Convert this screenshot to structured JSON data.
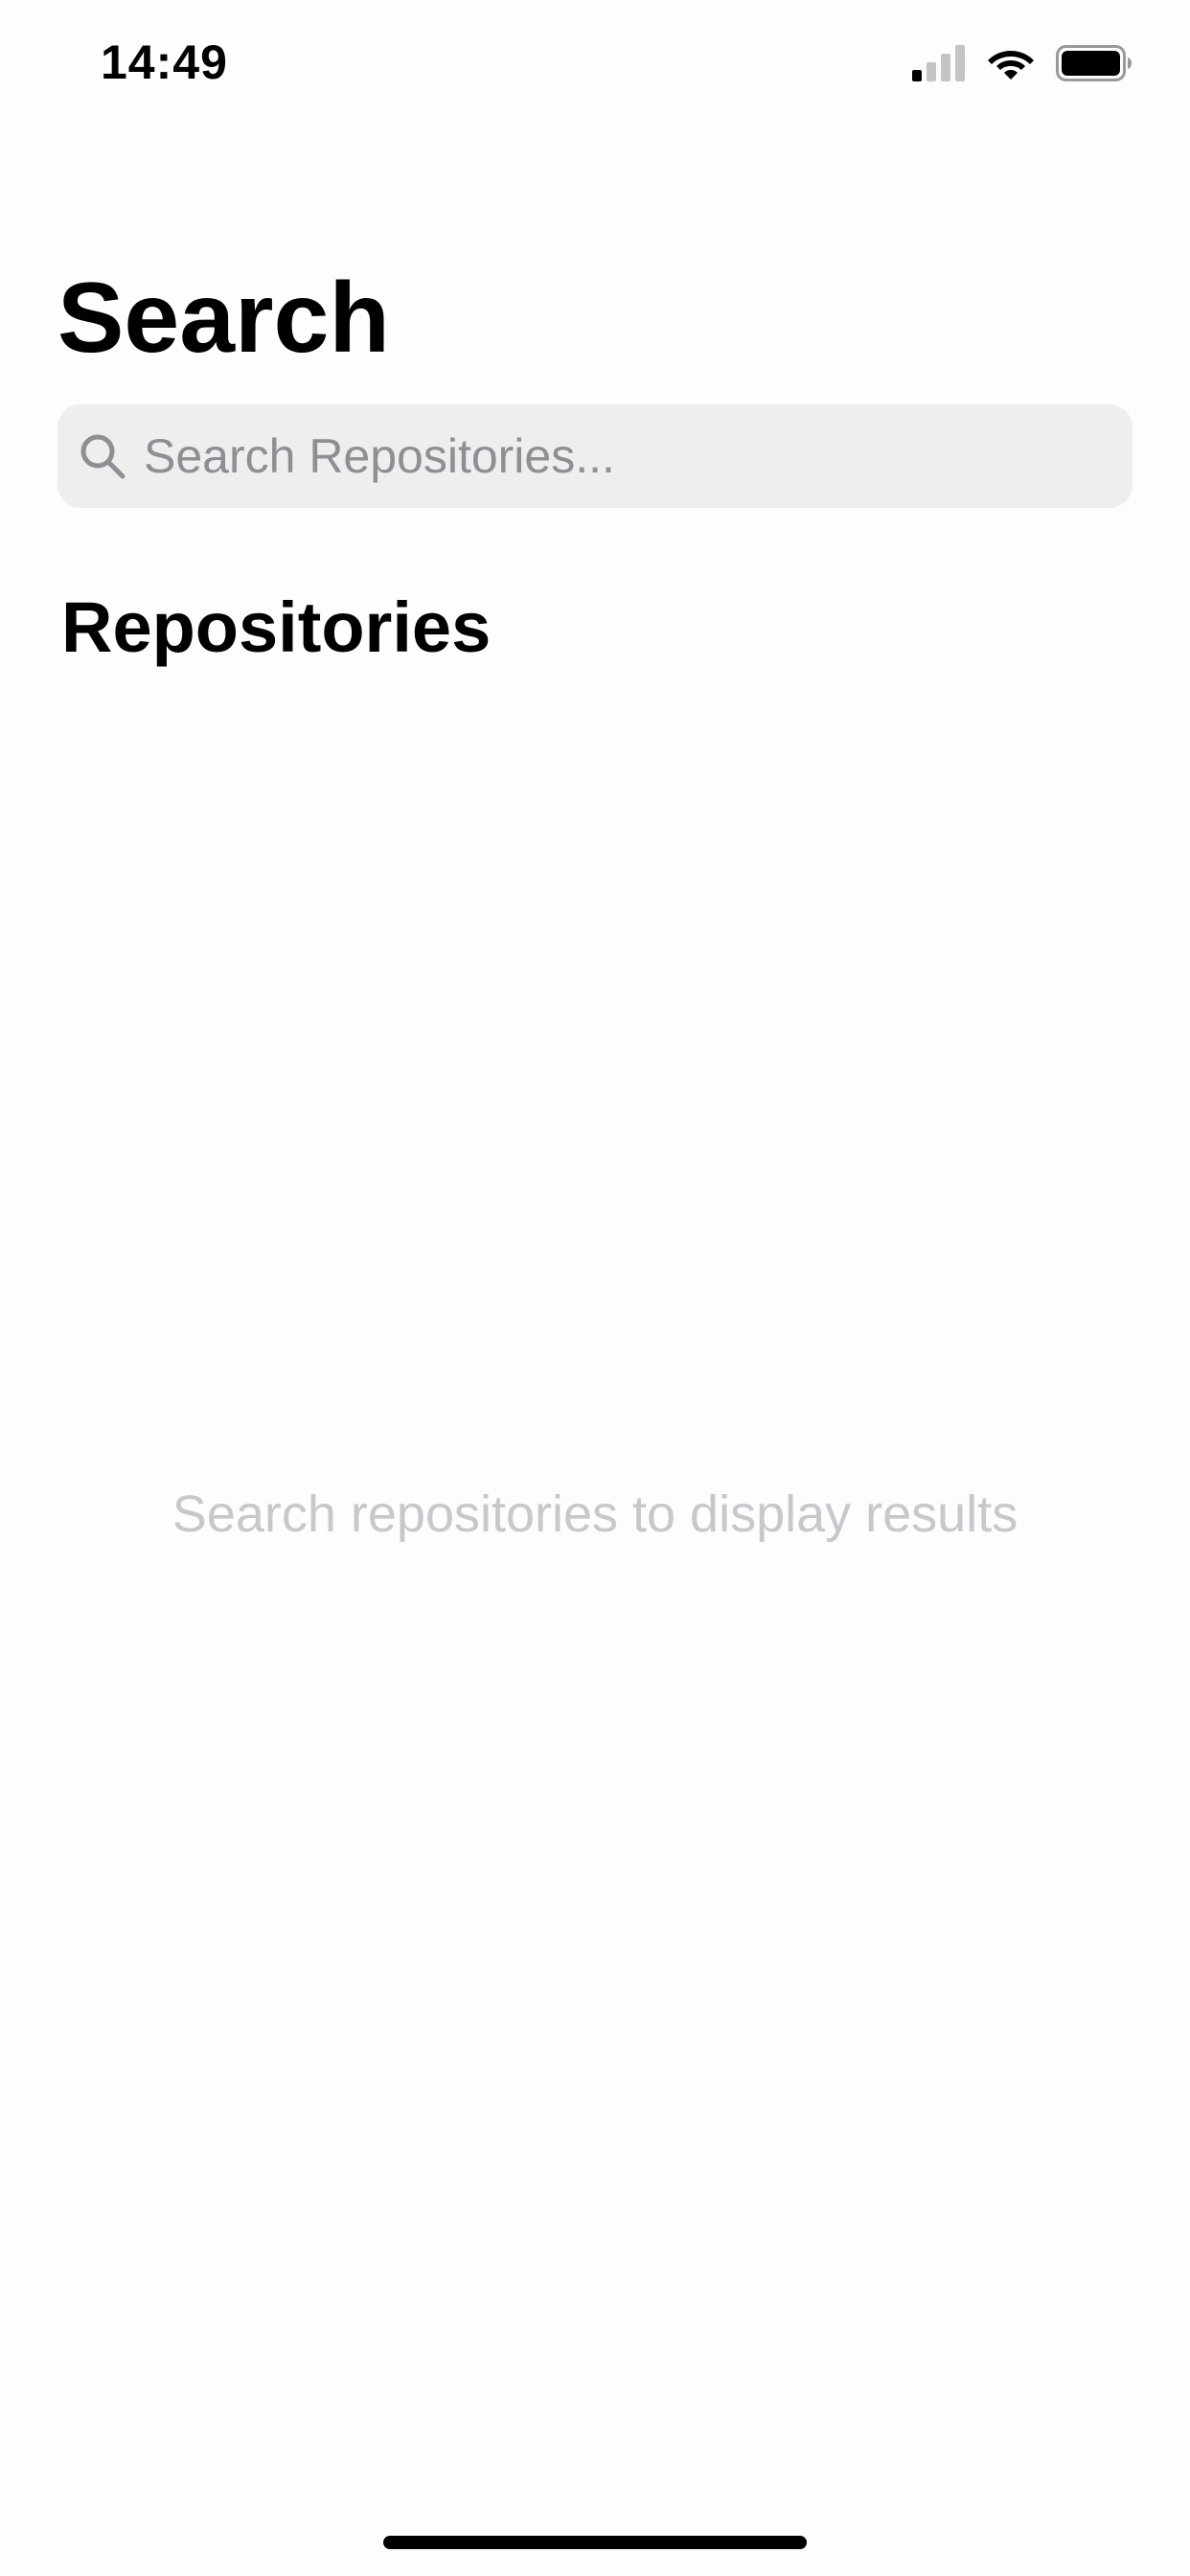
{
  "status_bar": {
    "time": "14:49",
    "signal_icon": "cellular-signal-icon",
    "wifi_icon": "wifi-icon",
    "battery_icon": "battery-icon",
    "signal_bars_active": 1,
    "signal_bars_total": 4
  },
  "page": {
    "title": "Search"
  },
  "search": {
    "placeholder": "Search Repositories...",
    "value": "",
    "icon": "search-icon"
  },
  "section": {
    "title": "Repositories"
  },
  "empty_state": {
    "message": "Search repositories to display results"
  },
  "colors": {
    "background": "#fdfdfd",
    "search_field_bg": "#eeeeef",
    "placeholder": "#8e8e93",
    "empty_text": "#c7c7cc",
    "text_primary": "#000000"
  }
}
